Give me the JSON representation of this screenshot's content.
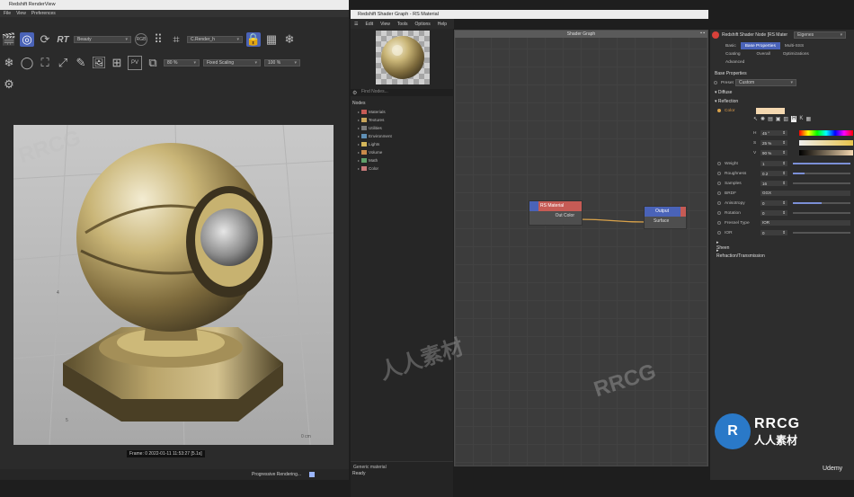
{
  "render_view": {
    "title": "Redshift RenderView",
    "menu": [
      "File",
      "View",
      "Preferences"
    ],
    "toolbar": {
      "beauty_dropdown": "Beauty",
      "rgb_label": "RGB",
      "rt_label": "RT",
      "camera_dropdown": "C.Render_h",
      "zoom_dropdown": "80 %",
      "scaling_dropdown": "Fixed Scaling",
      "exposure_dropdown": "100 %"
    },
    "ruler_labels": [
      "4",
      "5"
    ],
    "ruler_unit": "0 cm",
    "frame_info": "Frame: 0  2022-01-11  11:53:27  [5.1s]",
    "status": "Progressive Rendering..."
  },
  "shader_graph": {
    "title": "Redshift Shader Graph - RS Material",
    "menu": [
      "Edit",
      "View",
      "Tools",
      "Options",
      "Help"
    ],
    "search_placeholder": "Find Nodes...",
    "nodes_header": "Nodes",
    "categories": [
      {
        "label": "Materials",
        "color": "#c65b55"
      },
      {
        "label": "Textures",
        "color": "#c9a55a"
      },
      {
        "label": "Utilities",
        "color": "#7a7a7a"
      },
      {
        "label": "Environment",
        "color": "#5f8fb5"
      },
      {
        "label": "Lights",
        "color": "#d4b65a"
      },
      {
        "label": "Volume",
        "color": "#c98a4a"
      },
      {
        "label": "Math",
        "color": "#5fa06a"
      },
      {
        "label": "Color",
        "color": "#c77a7a"
      }
    ],
    "description": "Generic material",
    "status": "Ready",
    "graph_title": "Shader Graph",
    "material_node": {
      "title": "RS Material",
      "port": "Out Color"
    },
    "output_node": {
      "title": "Output",
      "port": "Surface"
    }
  },
  "attributes": {
    "header": "Redshift Shader Node [RS Mater",
    "header_dropdown": "Eigenes",
    "tabs_row1": [
      "Basic",
      "Base Properties",
      "Multi-SSS"
    ],
    "tabs_row2": [
      "Coating",
      "Overall",
      "Optimizations"
    ],
    "tabs_row3": [
      "Advanced"
    ],
    "section": "Base Properties",
    "preset_label": "Preset",
    "preset_value": "Custom",
    "diffuse_label": "Diffuse",
    "reflection_label": "Reflection",
    "color_label": "Color",
    "color_value": "#f4d8b0",
    "hsv": [
      {
        "label": "H",
        "value": "45 °"
      },
      {
        "label": "S",
        "value": "25 %"
      },
      {
        "label": "V",
        "value": "90 %"
      }
    ],
    "params": [
      {
        "name": "Weight",
        "value": "1",
        "fill": 1.0
      },
      {
        "name": "Roughness",
        "value": "0.2",
        "fill": 0.2
      },
      {
        "name": "Samples",
        "value": "16",
        "fill": 0.0
      },
      {
        "name": "BRDF",
        "value": "GGX",
        "type": "dropdown"
      },
      {
        "name": "Anisotropy",
        "value": "0",
        "fill": 0.5
      },
      {
        "name": "Rotation",
        "value": "0",
        "fill": 0.0
      },
      {
        "name": "Fresnel Type",
        "value": "IOR",
        "type": "dropdown"
      },
      {
        "name": "IOR",
        "value": "0",
        "fill": 0.0
      }
    ],
    "sheen_label": "Sheen",
    "refraction_label": "Refraction/Transmission"
  },
  "watermark": {
    "latin": "RRCG",
    "cjk": "人人素材"
  },
  "branding": {
    "logo_text": "RRCG",
    "logo_sub": "人人素材",
    "udemy": "Udemy"
  }
}
